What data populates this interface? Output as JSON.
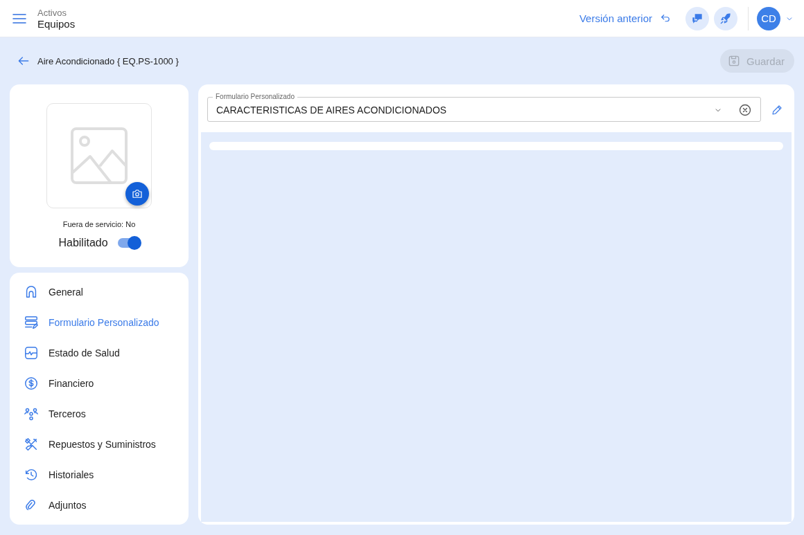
{
  "header": {
    "breadcrumb_parent": "Activos",
    "breadcrumb_current": "Equipos",
    "previous_version_link": "Versión anterior",
    "avatar_initials": "CD"
  },
  "page": {
    "title": "Aire Acondicionado { EQ.PS-1000 }",
    "save_button": {
      "label": "Guardar",
      "disabled": true
    }
  },
  "asset_card": {
    "out_of_service": "Fuera de servicio: No",
    "enabled_label": "Habilitado",
    "enabled": {
      "on": true
    }
  },
  "nav": {
    "items": [
      {
        "label": "General",
        "selected": false
      },
      {
        "label": "Formulario Personalizado",
        "selected": true
      },
      {
        "label": "Estado de Salud",
        "selected": false
      },
      {
        "label": "Financiero",
        "selected": false
      },
      {
        "label": "Terceros",
        "selected": false
      },
      {
        "label": "Repuestos y Suministros",
        "selected": false
      },
      {
        "label": "Historiales",
        "selected": false
      },
      {
        "label": "Adjuntos",
        "selected": false
      }
    ]
  },
  "form_select": {
    "label": "Formulario Personalizado",
    "value": "CARACTERISTICAS DE AIRES ACONDICIONADOS"
  }
}
